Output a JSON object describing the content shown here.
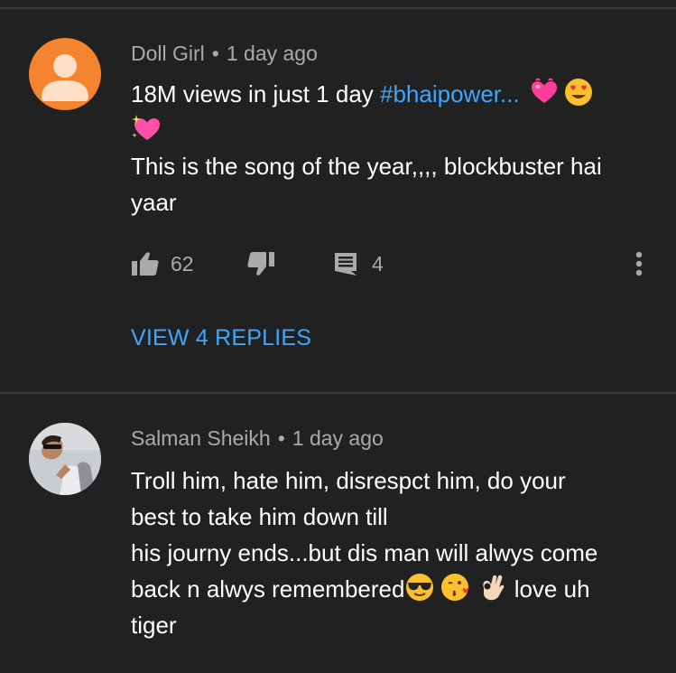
{
  "comments": [
    {
      "author": "Doll Girl",
      "time": "1 day ago",
      "avatar": "default-person-avatar",
      "avatar_color": "#f4842d",
      "lines": {
        "l1": "18M views in just 1 day ",
        "hashtag": "#bhaipower...",
        "l2": "This is the song of the year,,,, blockbuster hai",
        "l3": "yaar"
      },
      "emojis": [
        "heart-with-ribbon-icon",
        "heart-eyes-icon",
        "sparkling-heart-icon"
      ],
      "likes": "62",
      "replies": "4",
      "view_replies_label": "VIEW 4 REPLIES"
    },
    {
      "author": "Salman Sheikh",
      "time": "1 day ago",
      "avatar": "profile-photo",
      "lines": {
        "l1": "Troll him, hate him, disrespct him, do your",
        "l2": "best to take him down till",
        "l3": "his journy ends...but dis man will alwys come",
        "l4a": "back n alwys remembered",
        "l4b": " love uh",
        "l5": "tiger"
      },
      "emojis": [
        "sunglasses-face-icon",
        "kissing-heart-icon",
        "ok-hand-icon"
      ]
    }
  ],
  "colors": {
    "background": "#212121",
    "secondary_text": "#aaaaaa",
    "link": "#3ea6ff",
    "divider": "#3a3a3a"
  }
}
